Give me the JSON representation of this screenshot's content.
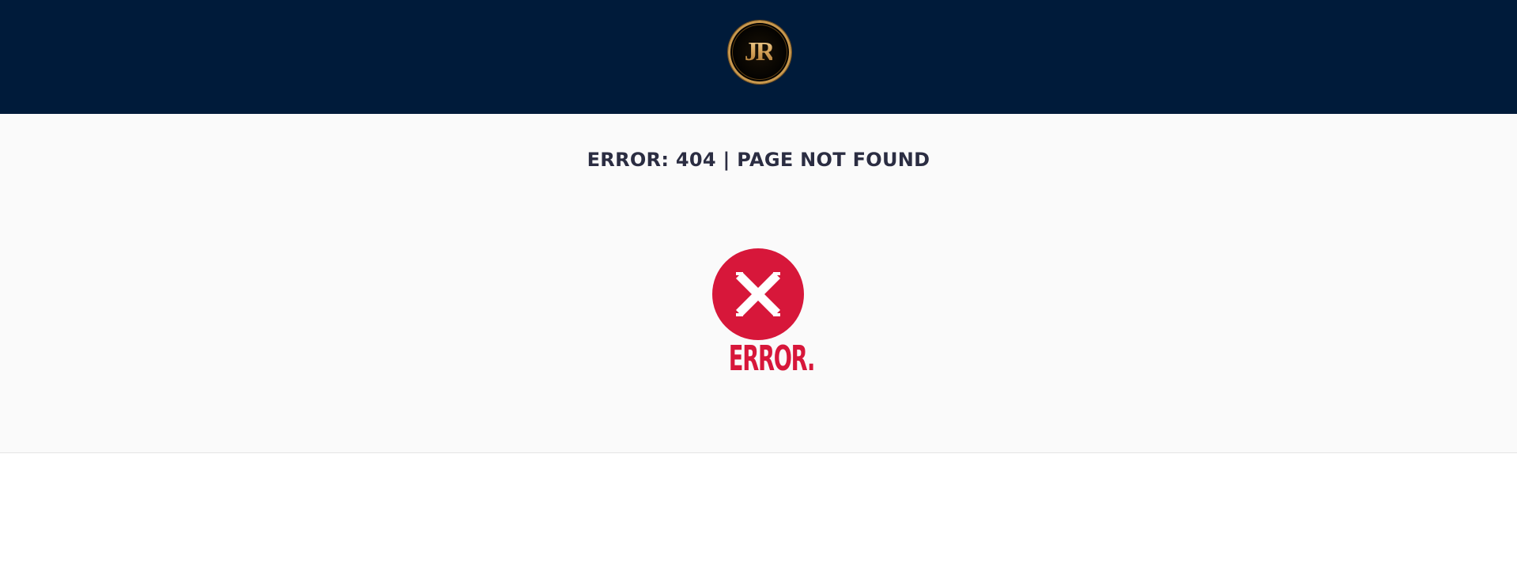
{
  "header": {
    "logo_text": "JR",
    "background_color": "#001b3a",
    "logo_gold": "#d7a55c"
  },
  "main": {
    "title": "ERROR: 404 | PAGE NOT FOUND",
    "error_illustration": {
      "icon": "close-x-icon",
      "word": "ERROR.",
      "color": "#d7173a"
    }
  }
}
